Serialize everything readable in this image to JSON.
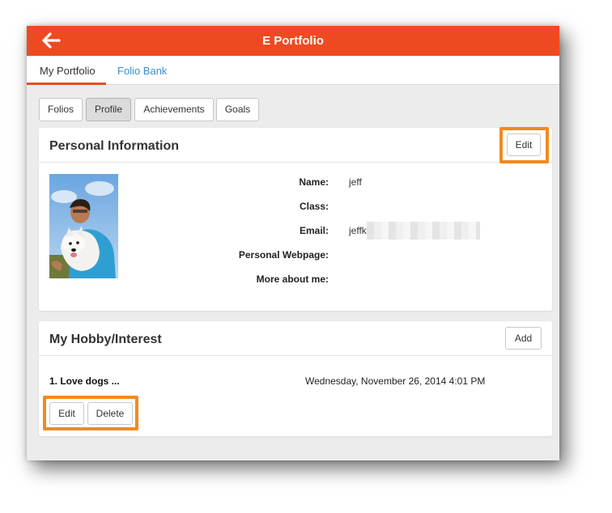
{
  "app": {
    "title": "E Portfolio",
    "back_icon": "arrow-left-icon",
    "accent": "#ee4a22",
    "highlight": "#f28a1e",
    "link": "#3a8fcf"
  },
  "tabs": [
    {
      "label": "My Portfolio",
      "active": true
    },
    {
      "label": "Folio Bank",
      "active": false
    }
  ],
  "segments": [
    {
      "label": "Folios",
      "active": false
    },
    {
      "label": "Profile",
      "active": true
    },
    {
      "label": "Achievements",
      "active": false
    },
    {
      "label": "Goals",
      "active": false
    }
  ],
  "personal_info": {
    "title": "Personal Information",
    "edit_label": "Edit",
    "fields": [
      {
        "label": "Name:",
        "value": "jeff"
      },
      {
        "label": "Class:",
        "value": ""
      },
      {
        "label": "Email:",
        "value": "jeffk"
      },
      {
        "label": "Personal Webpage:",
        "value": ""
      },
      {
        "label": "More about me:",
        "value": ""
      }
    ]
  },
  "hobby": {
    "title": "My Hobby/Interest",
    "add_label": "Add",
    "items": [
      {
        "name": "1. Love dogs ...",
        "date": "Wednesday, November 26, 2014 4:01 PM"
      }
    ],
    "edit_label": "Edit",
    "delete_label": "Delete"
  }
}
